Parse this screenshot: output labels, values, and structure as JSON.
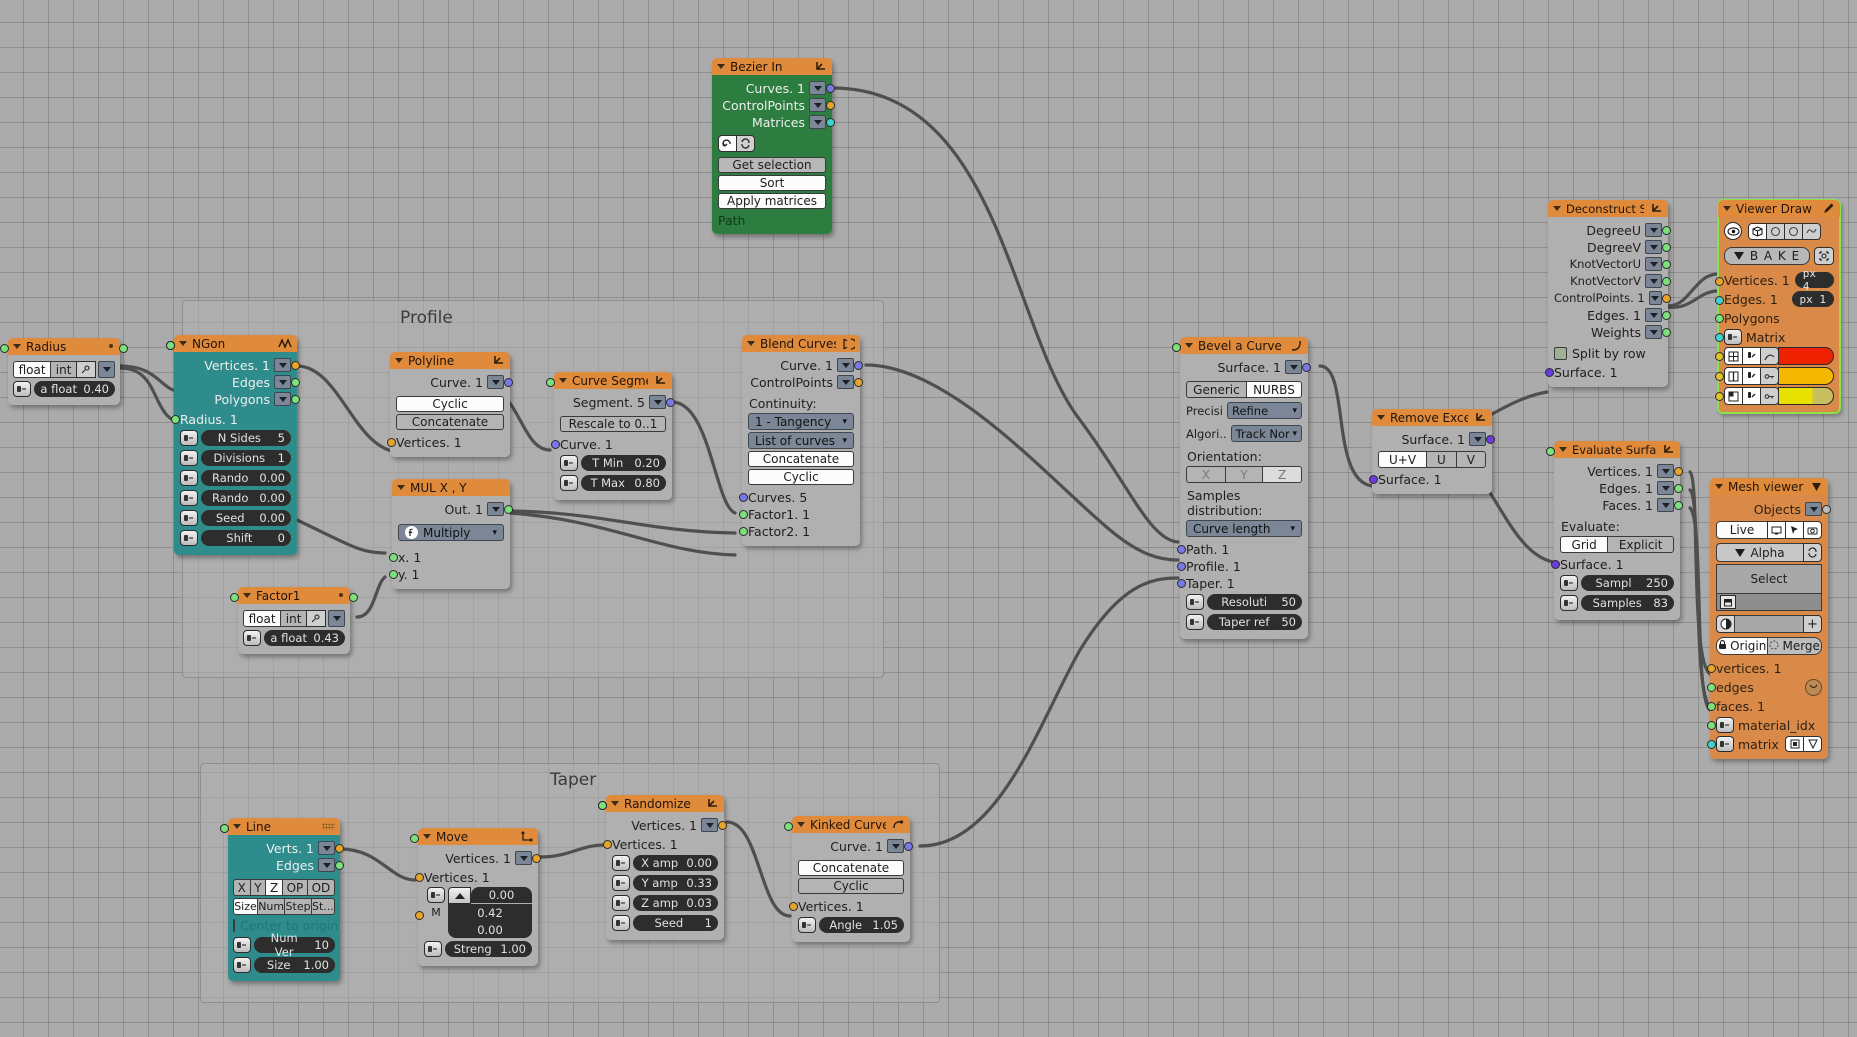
{
  "app": {
    "editor": "Sverchok Node Editor",
    "background_color": "#ababab",
    "header_color": "#e08b3c"
  },
  "frames": [
    {
      "label": "Profile"
    },
    {
      "label": "Taper"
    }
  ],
  "nodes": {
    "bezier_in": {
      "title": "Bezier In",
      "icon": "empty-arrows-icon",
      "outputs": [
        {
          "label": "Curves. 1",
          "socket": "blue"
        },
        {
          "label": "ControlPoints",
          "socket": "orange"
        },
        {
          "label": "Matrices",
          "socket": "cyan"
        }
      ],
      "toggle_icons": [
        "update-icon",
        "refresh-icon"
      ],
      "buttons": [
        {
          "label": "Get selection",
          "state": "normal"
        },
        {
          "label": "Sort",
          "state": "on"
        },
        {
          "label": "Apply matrices",
          "state": "on"
        }
      ],
      "footer": "Path"
    },
    "radius": {
      "title": "Radius",
      "tabs": [
        {
          "label": "float",
          "state": "on"
        },
        {
          "label": "int",
          "state": "off"
        }
      ],
      "field": {
        "name": "a float",
        "value": "0.40"
      }
    },
    "ngon": {
      "title": "NGon",
      "icon": "ngon-icon",
      "outputs": [
        {
          "label": "Vertices. 1",
          "socket": "orange"
        },
        {
          "label": "Edges",
          "socket": "green"
        },
        {
          "label": "Polygons",
          "socket": "green"
        }
      ],
      "inputs": [
        {
          "label": "Radius. 1",
          "socket": "green"
        }
      ],
      "fields": [
        {
          "name": "N Sides",
          "value": "5"
        },
        {
          "name": "Divisions",
          "value": "1"
        },
        {
          "name": "Rando",
          "value": "0.00"
        },
        {
          "name": "Rando",
          "value": "0.00"
        },
        {
          "name": "Seed",
          "value": "0.00"
        },
        {
          "name": "Shift",
          "value": "0"
        }
      ]
    },
    "polyline": {
      "title": "Polyline",
      "icon": "empty-arrows-icon",
      "outputs": [
        {
          "label": "Curve. 1",
          "socket": "blue"
        }
      ],
      "buttons": [
        {
          "label": "Cyclic",
          "state": "on"
        },
        {
          "label": "Concatenate",
          "state": "dim"
        }
      ],
      "inputs": [
        {
          "label": "Vertices. 1",
          "socket": "orange"
        }
      ]
    },
    "mul_xy": {
      "title": "MUL X , Y",
      "outputs": [
        {
          "label": "Out. 1",
          "socket": "green"
        }
      ],
      "operation": "Multiply",
      "inputs": [
        {
          "label": "x. 1",
          "socket": "green"
        },
        {
          "label": "y. 1",
          "socket": "green"
        }
      ]
    },
    "factor1": {
      "title": "Factor1",
      "tabs": [
        {
          "label": "float",
          "state": "on"
        },
        {
          "label": "int",
          "state": "off"
        }
      ],
      "field": {
        "name": "a float",
        "value": "0.43"
      }
    },
    "curve_segment": {
      "title": "Curve Segment",
      "icon": "empty-arrows-icon",
      "outputs": [
        {
          "label": "Segment. 5",
          "socket": "blue"
        }
      ],
      "buttons": [
        {
          "label": "Rescale to 0..1",
          "state": "dim"
        }
      ],
      "inputs": [
        {
          "label": "Curve. 1",
          "socket": "blue"
        }
      ],
      "fields": [
        {
          "name": "T Min",
          "value": "0.20"
        },
        {
          "name": "T Max",
          "value": "0.80"
        }
      ]
    },
    "blend_curves": {
      "title": "Blend Curves",
      "icon": "blend-icon",
      "outputs": [
        {
          "label": "Curve. 1",
          "socket": "blue"
        },
        {
          "label": "ControlPoints",
          "socket": "orange"
        }
      ],
      "section_label": "Continuity:",
      "selects": [
        "1 - Tangency",
        "List of curves"
      ],
      "buttons": [
        {
          "label": "Concatenate",
          "state": "on"
        },
        {
          "label": "Cyclic",
          "state": "on"
        }
      ],
      "inputs": [
        {
          "label": "Curves. 5",
          "socket": "blue"
        },
        {
          "label": "Factor1. 1",
          "socket": "green"
        },
        {
          "label": "Factor2. 1",
          "socket": "green"
        }
      ]
    },
    "bevel_curve": {
      "title": "Bevel a Curve (...",
      "icon": "curve-icon",
      "outputs": [
        {
          "label": "Surface. 1",
          "socket": "blue"
        }
      ],
      "mode_tabs": [
        {
          "label": "Generic",
          "state": "off"
        },
        {
          "label": "NURBS",
          "state": "on"
        }
      ],
      "rows": [
        {
          "label": "Precisi",
          "value": "Refine"
        },
        {
          "label": "Algori..",
          "value": "Track Nor"
        }
      ],
      "orientation_label": "Orientation:",
      "orientation": [
        {
          "label": "X",
          "state": "off"
        },
        {
          "label": "Y",
          "state": "off"
        },
        {
          "label": "Z",
          "state": "on"
        }
      ],
      "samples_label": "Samples distribution:",
      "samples_value": "Curve length",
      "inputs": [
        {
          "label": "Path. 1",
          "socket": "blue"
        },
        {
          "label": "Profile. 1",
          "socket": "blue"
        },
        {
          "label": "Taper. 1",
          "socket": "blue"
        }
      ],
      "fields": [
        {
          "name": "Resoluti",
          "value": "50"
        },
        {
          "name": "Taper ref",
          "value": "50"
        }
      ]
    },
    "remove_excessive": {
      "title": "Remove Excessi",
      "icon": "empty-arrows-icon",
      "outputs": [
        {
          "label": "Surface. 1",
          "socket": "purple"
        }
      ],
      "direction": [
        {
          "label": "U+V",
          "state": "on"
        },
        {
          "label": "U",
          "state": "off"
        },
        {
          "label": "V",
          "state": "off"
        }
      ],
      "inputs": [
        {
          "label": "Surface. 1",
          "socket": "purple"
        }
      ]
    },
    "deconstruct_surface": {
      "title": "Deconstruct Su...",
      "icon": "empty-arrows-icon",
      "outputs": [
        {
          "label": "DegreeU",
          "socket": "green"
        },
        {
          "label": "DegreeV",
          "socket": "green"
        },
        {
          "label": "KnotVectorU",
          "socket": "green"
        },
        {
          "label": "KnotVectorV",
          "socket": "green"
        },
        {
          "label": "ControlPoints. 1",
          "socket": "orange"
        },
        {
          "label": "Edges. 1",
          "socket": "green"
        },
        {
          "label": "Weights",
          "socket": "green"
        }
      ],
      "checkbox": {
        "label": "Split by row",
        "checked": false
      },
      "inputs": [
        {
          "label": "Surface. 1",
          "socket": "purple"
        }
      ]
    },
    "evaluate_surface": {
      "title": "Evaluate Surface",
      "icon": "empty-arrows-icon",
      "outputs": [
        {
          "label": "Vertices. 1",
          "socket": "orange"
        },
        {
          "label": "Edges. 1",
          "socket": "green"
        },
        {
          "label": "Faces. 1",
          "socket": "green"
        }
      ],
      "section_label": "Evaluate:",
      "mode_tabs": [
        {
          "label": "Grid",
          "state": "on"
        },
        {
          "label": "Explicit",
          "state": "off"
        }
      ],
      "inputs": [
        {
          "label": "Surface. 1",
          "socket": "purple"
        }
      ],
      "fields": [
        {
          "name": "Sampl",
          "value": "250"
        },
        {
          "name": "Samples",
          "value": "83"
        }
      ]
    },
    "viewer_draw": {
      "title": "Viewer Draw",
      "icon": "pencil-icon",
      "selected": true,
      "display_icons": [
        "eye-icon",
        "cube-icon",
        "circle-icon",
        "circle2-icon",
        "surface-icon"
      ],
      "bake_label": "B A K E",
      "inputs": [
        {
          "label": "Vertices. 1",
          "socket": "orange",
          "pill": "px 4"
        },
        {
          "label": "Edges. 1",
          "socket": "cyan",
          "pill": "px 1"
        },
        {
          "label": "Polygons",
          "socket": "green"
        },
        {
          "label": "Matrix",
          "socket": "cyan"
        }
      ],
      "colors": [
        "#ee2200",
        "#f5b800",
        "#e8e000"
      ]
    },
    "mesh_viewer": {
      "title": "Mesh viewer",
      "icon": "down-triangle-icon",
      "outputs": [
        {
          "label": "Objects",
          "socket": "grey"
        }
      ],
      "live_label": "Live",
      "live_icons": [
        "monitor-icon",
        "cursor-icon",
        "camera-icon"
      ],
      "alpha_label": "Alpha",
      "select_label": "Select",
      "origin_label": "Origin",
      "merge_label": "Merge",
      "inputs": [
        {
          "label": "vertices. 1",
          "socket": "orange"
        },
        {
          "label": "edges",
          "socket": "green"
        },
        {
          "label": "faces. 1",
          "socket": "green"
        },
        {
          "label": "material_idx",
          "socket": "green"
        },
        {
          "label": "matrix",
          "socket": "cyan"
        }
      ]
    },
    "line": {
      "title": "Line",
      "outputs": [
        {
          "label": "Verts. 1",
          "socket": "orange"
        },
        {
          "label": "Edges",
          "socket": "green"
        }
      ],
      "axis": [
        {
          "label": "X",
          "state": "off"
        },
        {
          "label": "Y",
          "state": "off"
        },
        {
          "label": "Z",
          "state": "on"
        },
        {
          "label": "OP",
          "state": "off"
        },
        {
          "label": "OD",
          "state": "off"
        }
      ],
      "mode": [
        {
          "label": "Size",
          "state": "on"
        },
        {
          "label": "Num",
          "state": "off"
        },
        {
          "label": "Step",
          "state": "off"
        },
        {
          "label": "St...",
          "state": "off"
        }
      ],
      "checkbox": {
        "label": "Center to origin",
        "checked": false
      },
      "fields": [
        {
          "name": "Num Ver",
          "value": "10"
        },
        {
          "name": "Size",
          "value": "1.00"
        }
      ]
    },
    "move": {
      "title": "Move",
      "icon": "move-icon",
      "outputs": [
        {
          "label": "Vertices. 1",
          "socket": "orange"
        }
      ],
      "inputs": [
        {
          "label": "Vertices. 1",
          "socket": "orange"
        }
      ],
      "vector_label": "M",
      "vector": [
        "0.00",
        "0.42",
        "0.00"
      ],
      "fields": [
        {
          "name": "Streng",
          "value": "1.00"
        }
      ]
    },
    "randomize": {
      "title": "Randomize",
      "icon": "empty-arrows-icon",
      "outputs": [
        {
          "label": "Vertices. 1",
          "socket": "orange"
        }
      ],
      "inputs": [
        {
          "label": "Vertices. 1",
          "socket": "orange"
        }
      ],
      "fields": [
        {
          "name": "X amp",
          "value": "0.00"
        },
        {
          "name": "Y amp",
          "value": "0.33"
        },
        {
          "name": "Z amp",
          "value": "0.03"
        },
        {
          "name": "Seed",
          "value": "1"
        }
      ]
    },
    "kinked_curve": {
      "title": "Kinked Curve",
      "icon": "kink-icon",
      "outputs": [
        {
          "label": "Curve. 1",
          "socket": "blue"
        }
      ],
      "buttons": [
        {
          "label": "Concatenate",
          "state": "on"
        },
        {
          "label": "Cyclic",
          "state": "dim"
        }
      ],
      "inputs": [
        {
          "label": "Vertices. 1",
          "socket": "orange"
        }
      ],
      "fields": [
        {
          "name": "Angle",
          "value": "1.05"
        }
      ]
    }
  }
}
